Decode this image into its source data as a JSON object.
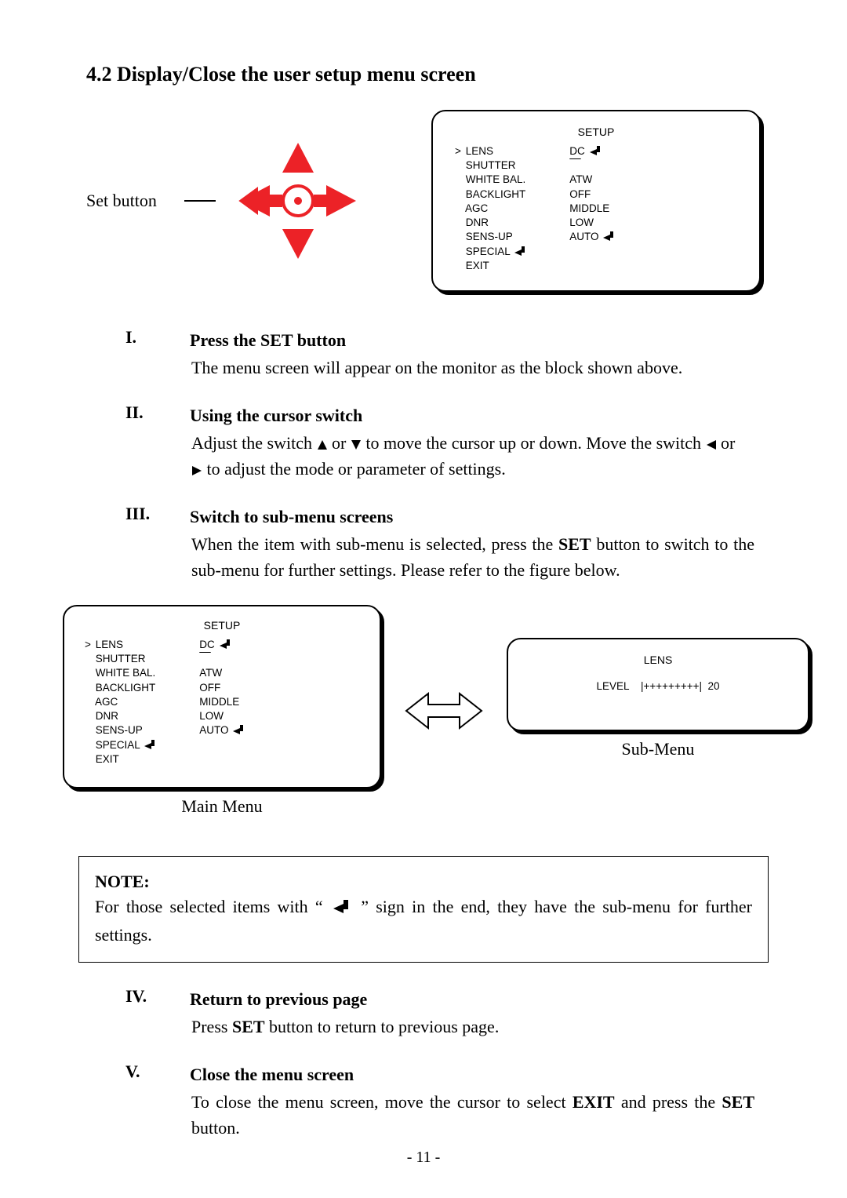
{
  "page": {
    "section_title": "4.2 Display/Close the user setup menu screen",
    "set_button_label": "Set button",
    "page_number": "- 11 -"
  },
  "joystick": {
    "icon": "joystick-cross"
  },
  "osd_main": {
    "title": "SETUP",
    "left": [
      {
        "cursor": ">",
        "label": "LENS",
        "enter": false
      },
      {
        "cursor": "",
        "label": "SHUTTER",
        "enter": false
      },
      {
        "cursor": "",
        "label": "WHITE BAL.",
        "enter": false
      },
      {
        "cursor": "",
        "label": "BACKLIGHT",
        "enter": false
      },
      {
        "cursor": "",
        "label": "AGC",
        "enter": false
      },
      {
        "cursor": "",
        "label": "DNR",
        "enter": false
      },
      {
        "cursor": "",
        "label": "SENS-UP",
        "enter": false
      },
      {
        "cursor": "",
        "label": "SPECIAL",
        "enter": true
      },
      {
        "cursor": "",
        "label": "EXIT",
        "enter": false
      }
    ],
    "right": [
      {
        "label": "DC",
        "enter": true,
        "dash": false
      },
      {
        "label": "",
        "enter": false,
        "dash": true
      },
      {
        "label": "ATW",
        "enter": false,
        "dash": false
      },
      {
        "label": "OFF",
        "enter": false,
        "dash": false
      },
      {
        "label": "MIDDLE",
        "enter": false,
        "dash": false
      },
      {
        "label": "LOW",
        "enter": false,
        "dash": false
      },
      {
        "label": "AUTO",
        "enter": true,
        "dash": false
      }
    ]
  },
  "osd_sub": {
    "title": "LENS",
    "level_label": "LEVEL",
    "level_bar": "|+++++++++|",
    "level_value": "20"
  },
  "captions": {
    "main_menu": "Main Menu",
    "sub_menu": "Sub-Menu"
  },
  "steps": {
    "i": {
      "num": "I.",
      "title": "Press the SET button",
      "text": "The menu screen will appear on the monitor as the block shown above."
    },
    "ii": {
      "num": "II.",
      "title": "Using the cursor switch",
      "text_a": "Adjust the switch ",
      "text_b": " or ",
      "text_c": " to move the cursor up or down. Move the switch ",
      "text_d": " or ",
      "text_e": " to adjust the mode or parameter of settings."
    },
    "iii": {
      "num": "III.",
      "title": "Switch to sub-menu screens",
      "text_a": "When the item with sub-menu is selected, press the ",
      "set": "SET",
      "text_b": " button to switch to the sub-menu for further settings. Please refer to the figure below."
    },
    "iv": {
      "num": "IV.",
      "title": "Return to previous page",
      "text_a": "Press ",
      "set": "SET",
      "text_b": " button to return to previous page."
    },
    "v": {
      "num": "V.",
      "title": "Close the menu screen",
      "text_a": "To close the menu screen, move the cursor to select ",
      "exit": "EXIT",
      "text_b": " and press the ",
      "set": "SET",
      "text_c": " button."
    }
  },
  "note": {
    "title": "NOTE:",
    "text_a": "For those selected items with “ ",
    "text_b": " ” sign in the end, they have the sub-menu for further settings."
  }
}
